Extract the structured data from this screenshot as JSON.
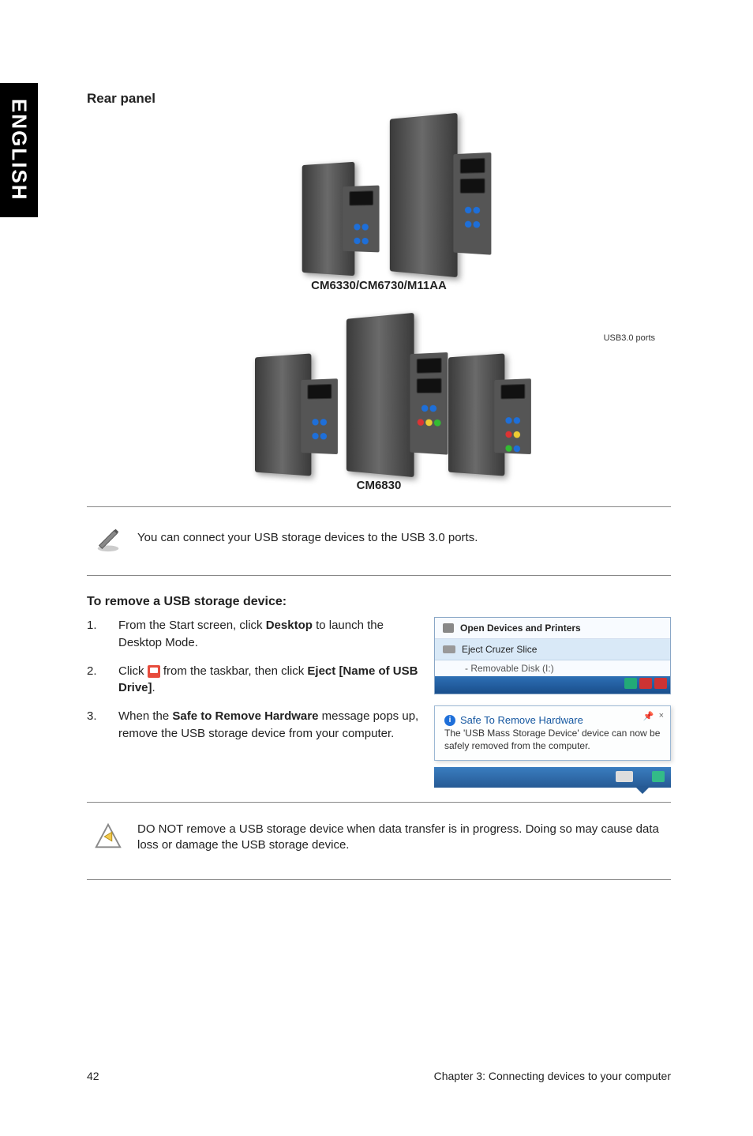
{
  "sidebar": {
    "language": "ENGLISH"
  },
  "rear_panel_heading": "Rear panel",
  "figures": {
    "fig1_label": "CM6330/CM6730/M11AA",
    "fig2_label": "CM6830",
    "usb3_callout": "USB3.0 ports"
  },
  "note_usb3": "You can connect your USB storage devices to the USB 3.0 ports.",
  "remove_heading": "To remove a USB storage device:",
  "steps": [
    {
      "num": "1.",
      "pre": "From the Start screen, click ",
      "bold": "Desktop",
      "post": " to launch the Desktop Mode."
    },
    {
      "num": "2.",
      "pre": "Click ",
      "mid": " from the taskbar, then click ",
      "bold": "Eject [Name of USB Drive]",
      "post": "."
    },
    {
      "num": "3.",
      "pre": "When the ",
      "bold": "Safe to Remove Hardware",
      "post": " message pops up, remove the USB storage device from your computer."
    }
  ],
  "eject_panel": {
    "row1": "Open Devices and Printers",
    "row2": "Eject Cruzer Slice",
    "row3": "-   Removable Disk (I:)"
  },
  "toast": {
    "title": "Safe To Remove Hardware",
    "body": "The 'USB Mass Storage Device' device can now be safely removed from the computer.",
    "pin_glyph": "📌",
    "close_glyph": "×"
  },
  "warning": "DO NOT remove a USB storage device when data transfer is in progress. Doing so may cause data loss or damage the USB storage device.",
  "footer": {
    "page": "42",
    "chapter": "Chapter 3: Connecting devices to your computer"
  }
}
